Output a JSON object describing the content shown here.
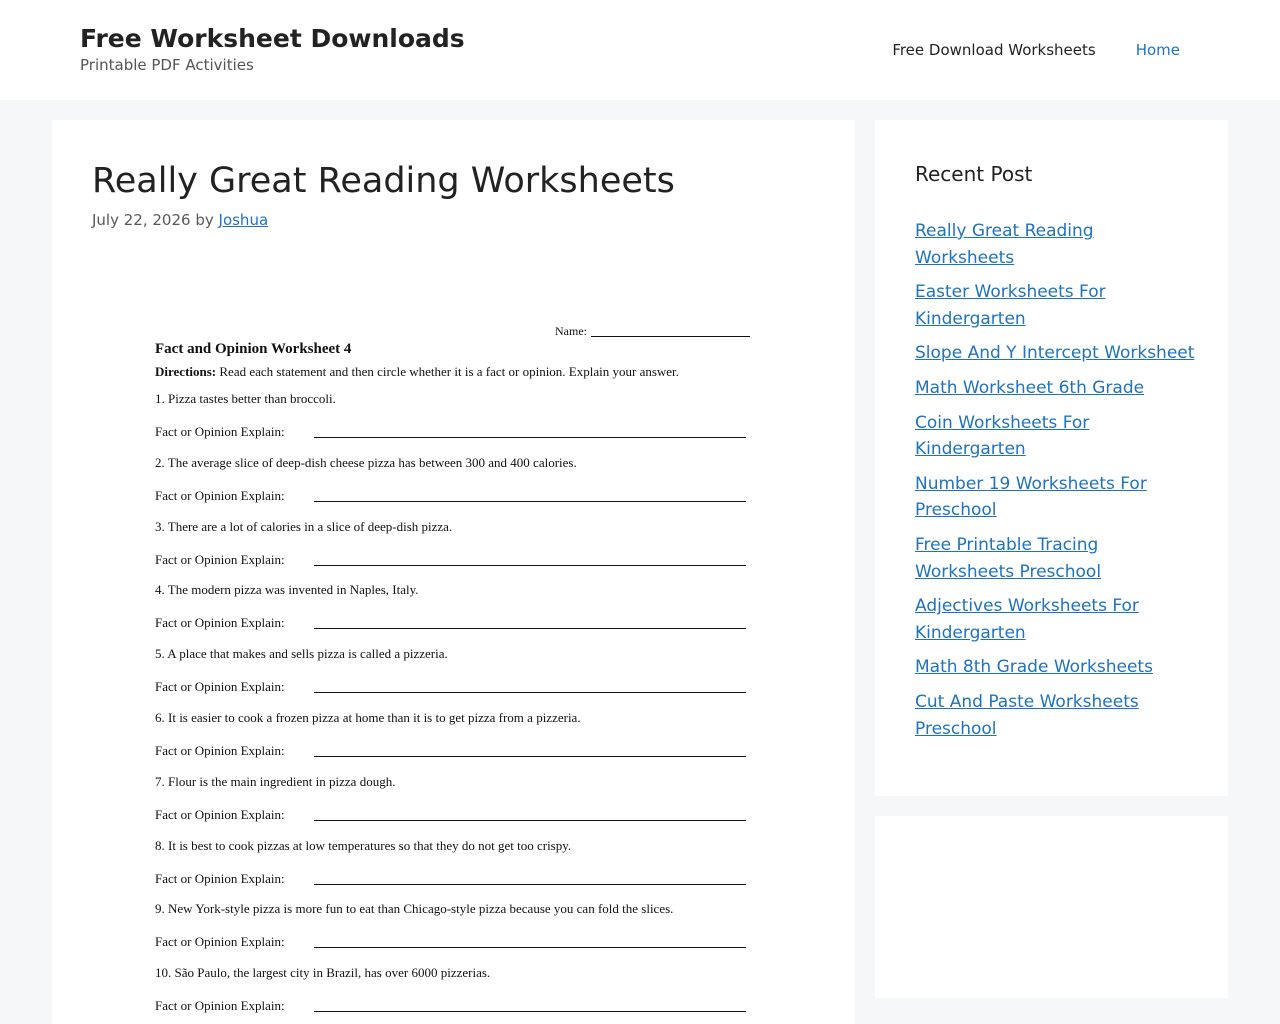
{
  "header": {
    "site_title": "Free Worksheet Downloads",
    "site_description": "Printable PDF Activities",
    "nav": [
      {
        "label": "Free Download Worksheets"
      },
      {
        "label": "Home"
      }
    ]
  },
  "article": {
    "title": "Really Great Reading Worksheets",
    "date": "July 22, 2026",
    "by": "by",
    "author": "Joshua"
  },
  "worksheet": {
    "name_label": "Name:",
    "title": "Fact and Opinion Worksheet 4",
    "directions_label": "Directions:",
    "directions_text": " Read each statement and then circle whether it is a fact or opinion.  Explain your answer.",
    "answer_label": "Fact  or  Opinion   Explain:",
    "questions": [
      "1.  Pizza tastes better than broccoli.",
      "2.  The average slice of deep-dish cheese pizza has between 300 and 400 calories.",
      "3.  There are a lot of calories in a slice of deep-dish pizza.",
      "4.  The modern pizza was invented in Naples, Italy.",
      "5.  A place that makes and sells pizza is called a pizzeria.",
      "6.  It is easier to cook a frozen pizza at home than it is to get pizza from a pizzeria.",
      "7.  Flour is the main ingredient in pizza dough.",
      "8.  It is best to cook pizzas at low temperatures so that they do not get too crispy.",
      "9.  New York-style pizza is more fun to eat than Chicago-style pizza because you can fold the slices.",
      "10.  São Paulo, the largest city in Brazil, has over 6000 pizzerias."
    ]
  },
  "sidebar": {
    "widget_title": "Recent Post",
    "recent_posts": [
      "Really Great Reading Worksheets",
      "Easter Worksheets For Kindergarten",
      "Slope And Y Intercept Worksheet",
      "Math Worksheet 6th Grade",
      "Coin Worksheets For Kindergarten",
      "Number 19 Worksheets For Preschool",
      "Free Printable Tracing Worksheets Preschool",
      "Adjectives Worksheets For Kindergarten",
      "Math 8th Grade Worksheets",
      "Cut And Paste Worksheets Preschool"
    ]
  },
  "colors": {
    "link": "#1e73be",
    "background": "#f6f7f9",
    "panel": "#ffffff"
  }
}
